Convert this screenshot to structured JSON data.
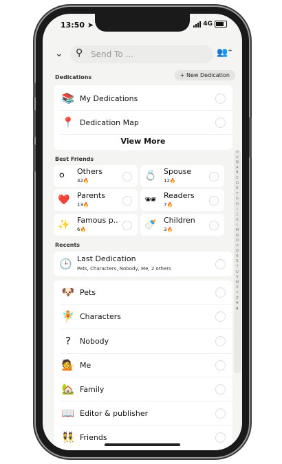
{
  "status": {
    "time": "13:50",
    "network": "4G"
  },
  "search": {
    "placeholder": "Send To ..."
  },
  "icons": {
    "back": "chevron-down-icon",
    "search": "magnifier-icon",
    "add_user": "add-user-icon"
  },
  "dedications": {
    "section_label": "Dedications",
    "new_button": "+ New Dedication",
    "items": [
      {
        "label": "My Dedications",
        "icon": "books-icon"
      },
      {
        "label": "Dedication Map",
        "icon": "location-pin-icon"
      }
    ],
    "view_more": "View More"
  },
  "best_friends": {
    "section_label": "Best Friends",
    "items": [
      {
        "name": "Others",
        "count": "32🔥",
        "icon": "circles-icon"
      },
      {
        "name": "Spouse",
        "count": "12🔥",
        "icon": "ring-icon"
      },
      {
        "name": "Parents",
        "count": "13🔥",
        "icon": "heart-icon"
      },
      {
        "name": "Readers",
        "count": "7🔥",
        "icon": "glasses-icon"
      },
      {
        "name": "Famous p..",
        "count": "6🔥",
        "icon": "sparkles-icon"
      },
      {
        "name": "Children",
        "count": "3🔥",
        "icon": "baby-bottle-icon"
      }
    ]
  },
  "recents": {
    "section_label": "Recents",
    "last": {
      "title": "Last Dedication",
      "subtitle": "Pets, Characters, Nobody, Me, 2 others"
    },
    "items": [
      {
        "label": "Pets",
        "icon": "dog-icon"
      },
      {
        "label": "Characters",
        "icon": "fairy-icon"
      },
      {
        "label": "Nobody",
        "icon": "question-icon"
      },
      {
        "label": "Me",
        "icon": "person-icon"
      },
      {
        "label": "Family",
        "icon": "house-icon"
      },
      {
        "label": "Editor & publisher",
        "icon": "book-icon"
      },
      {
        "label": "Friends",
        "icon": "friends-icon"
      }
    ]
  },
  "index_letters": [
    "⊙",
    "⊙",
    "☺",
    "A",
    "B",
    "C",
    "D",
    "E",
    "F",
    "G",
    "H",
    "I",
    "J",
    "K",
    "L",
    "M",
    "N",
    "O",
    "P",
    "Q",
    "R",
    "S",
    "T",
    "U",
    "V",
    "W",
    "X",
    "Y",
    "Z",
    "#",
    "♟"
  ]
}
